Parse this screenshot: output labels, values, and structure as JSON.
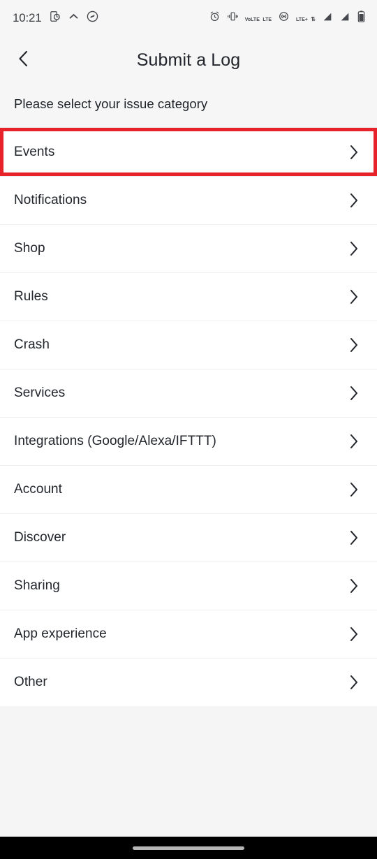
{
  "statusbar": {
    "time": "10:21",
    "left_icons": [
      "screenshot-phone-icon",
      "chevron-up-icon",
      "shazam-icon"
    ],
    "right_icons": [
      "alarm-clock-icon",
      "vibrate-icon",
      "volte-icon",
      "hotspot-icon",
      "lte-plus-icon",
      "signal-bars-icon",
      "signal-bars-2-icon",
      "battery-icon"
    ],
    "volte_line1": "VoLTE",
    "volte_line2": "LTE",
    "lte_label": "LTE+"
  },
  "header": {
    "back_icon": "chevron-left-icon",
    "title": "Submit a Log"
  },
  "subtitle": "Please select your issue category",
  "list": {
    "chevron_icon": "chevron-right-icon",
    "items": [
      {
        "label": "Events",
        "highlighted": true
      },
      {
        "label": "Notifications",
        "highlighted": false
      },
      {
        "label": "Shop",
        "highlighted": false
      },
      {
        "label": "Rules",
        "highlighted": false
      },
      {
        "label": "Crash",
        "highlighted": false
      },
      {
        "label": "Services",
        "highlighted": false
      },
      {
        "label": "Integrations (Google/Alexa/IFTTT)",
        "highlighted": false
      },
      {
        "label": "Account",
        "highlighted": false
      },
      {
        "label": "Discover",
        "highlighted": false
      },
      {
        "label": "Sharing",
        "highlighted": false
      },
      {
        "label": "App experience",
        "highlighted": false
      },
      {
        "label": "Other",
        "highlighted": false
      }
    ]
  },
  "annotation": {
    "color": "#e8222a",
    "target": "Events"
  },
  "navbar": {
    "home_indicator": "home-indicator-pill"
  },
  "colors": {
    "page_background": "#f5f5f5",
    "list_background": "#ffffff",
    "text_primary": "#22262c",
    "navbar": "#000000"
  }
}
